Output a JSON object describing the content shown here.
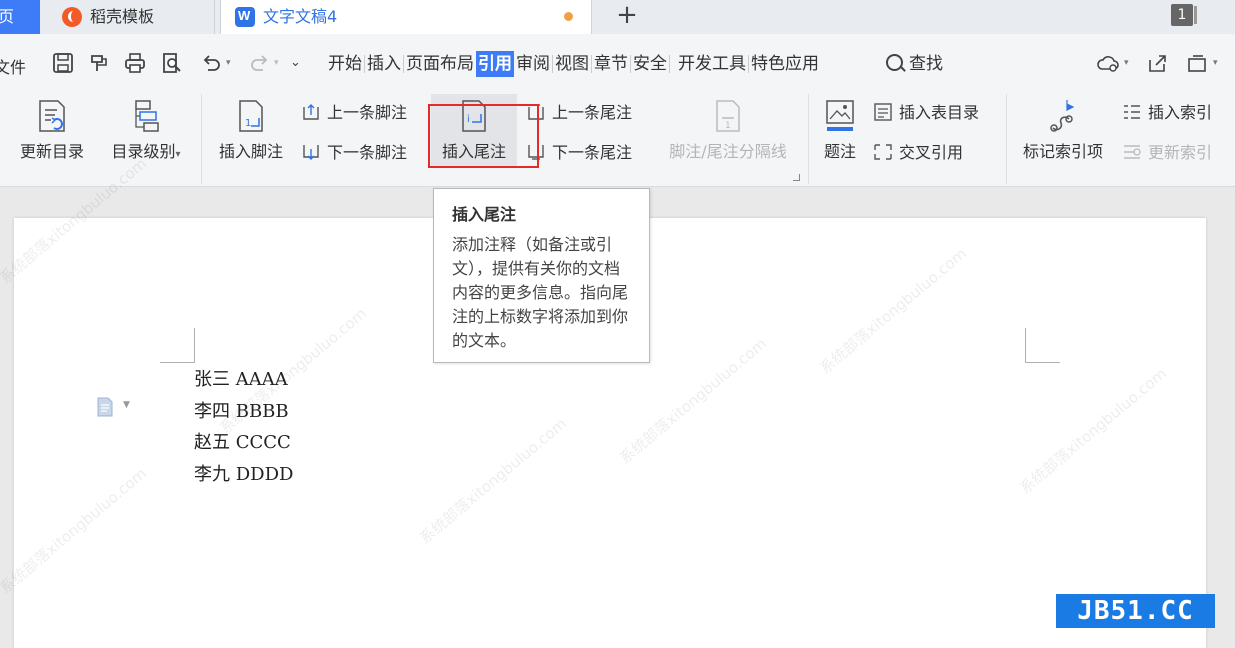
{
  "tabs": {
    "home_label": "页",
    "items": [
      {
        "label": "稻壳模板"
      },
      {
        "label": "文字文稿4"
      }
    ],
    "new_tab": "+",
    "window_count": "1"
  },
  "menubar": {
    "file_label": "文件",
    "items": [
      "开始",
      "插入",
      "页面布局",
      "引用",
      "审阅",
      "视图",
      "章节",
      "安全",
      "开发工具",
      "特色应用"
    ],
    "active": "引用",
    "search_label": "查找"
  },
  "ribbon": {
    "update_toc": "更新目录",
    "toc_level": "目录级别",
    "insert_footnote": "插入脚注",
    "prev_footnote": "上一条脚注",
    "next_footnote": "下一条脚注",
    "insert_endnote": "插入尾注",
    "prev_endnote": "上一条尾注",
    "next_endnote": "下一条尾注",
    "note_separator": "脚注/尾注分隔线",
    "caption": "题注",
    "insert_table_of_figures": "插入表目录",
    "cross_reference": "交叉引用",
    "mark_index_entry": "标记索引项",
    "insert_index": "插入索引",
    "update_index": "更新索引"
  },
  "tooltip": {
    "title": "插入尾注",
    "body": "添加注释（如备注或引文），提供有关你的文档内容的更多信息。指向尾注的上标数字将添加到你的文本。"
  },
  "document": {
    "lines": [
      "张三 AAAA",
      "李四 BBBB",
      "赵五 CCCC",
      "李九 DDDD"
    ]
  },
  "watermark_text": "系统部落xitongbuluo.com",
  "badge": "JB51.CC",
  "colors": {
    "accent": "#3e7cf7",
    "highlight_border": "#e32b2b",
    "badge": "#1b7be5"
  }
}
